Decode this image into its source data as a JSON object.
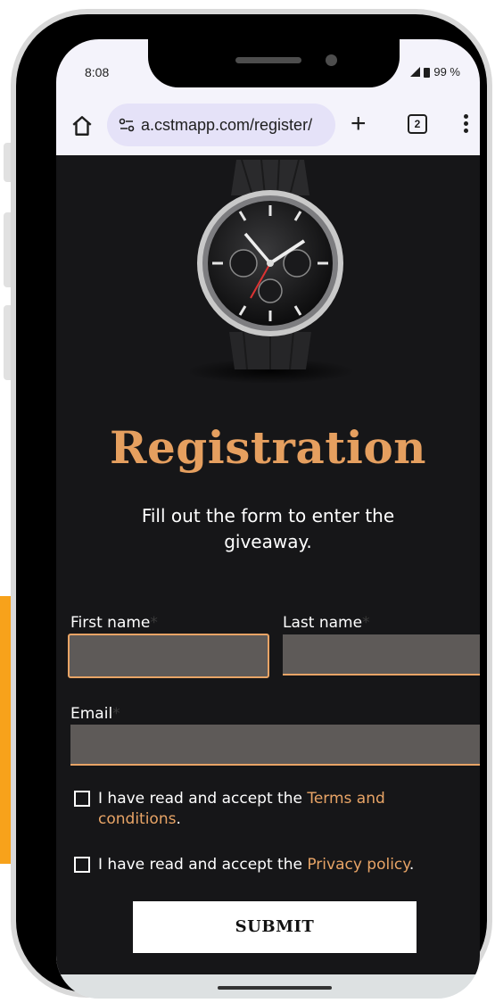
{
  "status_bar": {
    "time": "8:08",
    "battery": "99 %"
  },
  "browser": {
    "url": "a.cstmapp.com/register/",
    "tab_count": "2"
  },
  "page": {
    "title": "Registration",
    "subtitle": "Fill out the form to enter the giveaway.",
    "form": {
      "first_name_label": "First name",
      "last_name_label": "Last name",
      "email_label": "Email",
      "required_marker": "*",
      "first_name_value": "",
      "last_name_value": "",
      "email_value": ""
    },
    "terms": {
      "prefix": "I have read and accept the ",
      "link": "Terms and conditions",
      "suffix": "."
    },
    "privacy": {
      "prefix": "I have read and accept the ",
      "link": "Privacy policy",
      "suffix": "."
    },
    "submit_label": "SUBMIT"
  },
  "colors": {
    "accent": "#e59f5f",
    "background": "#161618",
    "field": "#5e5a58",
    "side_strip": "#f7a21b"
  }
}
